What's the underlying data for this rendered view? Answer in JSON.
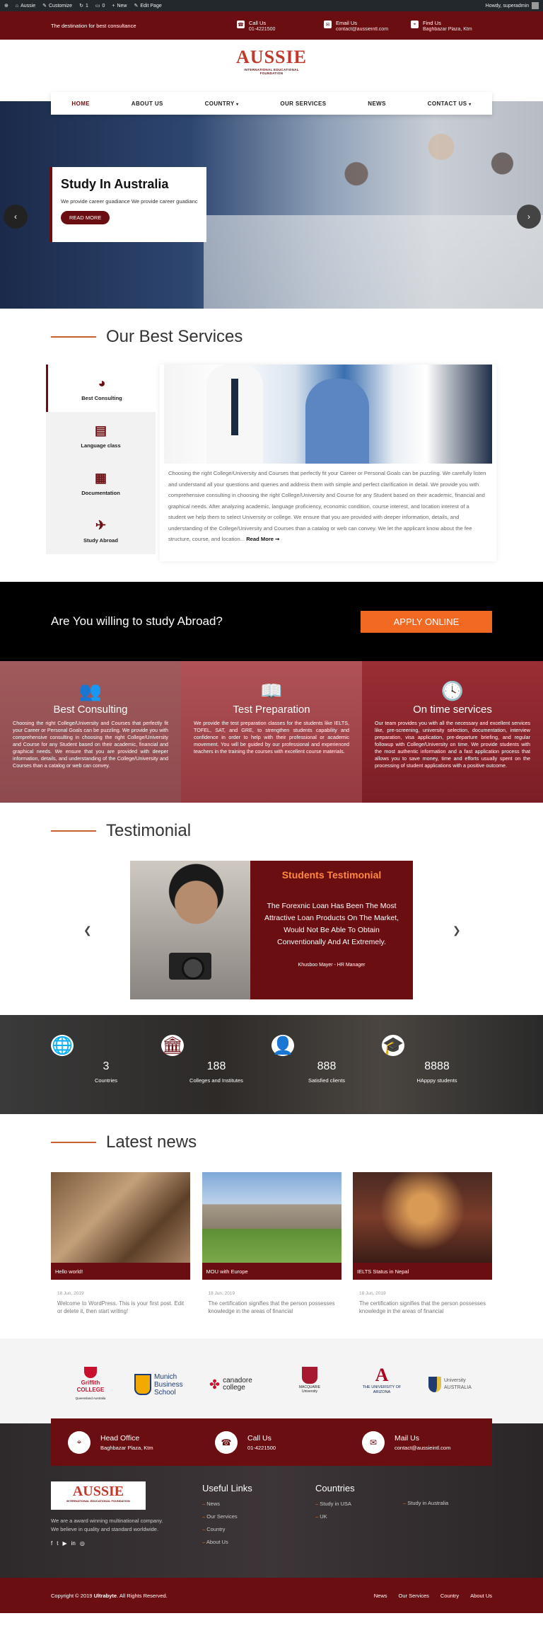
{
  "admin_bar": {
    "site": "Aussie",
    "customize": "Customize",
    "comments": "1",
    "updates": "0",
    "new": "New",
    "edit": "Edit Page",
    "howdy": "Howdy, superadmin"
  },
  "topbar": {
    "tagline": "The destination for best consultance",
    "call_label": "Call Us",
    "call_value": "01-4221500",
    "email_label": "Email Us",
    "email_value": "contact@aussieintl.com",
    "find_label": "Find Us",
    "find_value": "Baghbazar Plaza, Ktm"
  },
  "logo": {
    "brand_a": "AUSS",
    "brand_b": "IE",
    "subtitle": "INTERNATIONAL EDUCATIONAL FOUNDATION"
  },
  "nav": {
    "items": [
      "HOME",
      "ABOUT US",
      "COUNTRY",
      "OUR SERVICES",
      "NEWS",
      "CONTACT US"
    ]
  },
  "hero": {
    "title": "Study In Australia",
    "text": "We provide career guadiance We provide career guadianc",
    "button": "READ MORE"
  },
  "services": {
    "title": "Our Best Services",
    "tabs": [
      "Best Consulting",
      "Language class",
      "Documentation",
      "Study Abroad"
    ],
    "body": "Choosing the right College/University and Courses that perfectly fit your Career or Personal Goals can be puzzling. We carefully listen and understand all your questions and queries and address them with simple and perfect clarification in detail.  We provide you with comprehensive consulting in choosing the right College/University and Course for any Student based on their academic, financial and graphical needs. After analyzing academic, language proficiency, economic condition, course interest, and location interest of a student we help them to select University or college. We ensure that you are provided with deeper information, details, and understanding of the College/University and Courses than a catalog or web can convey.  We let the applicant know about the fee structure, course, and location...",
    "read_more": "Read More ➞"
  },
  "cta": {
    "text": "Are You willing to study Abroad?",
    "button": "APPLY ONLINE"
  },
  "features": [
    {
      "title": "Best Consulting",
      "text": "Choosing the right College/University and Courses that perfectly fit your Career or Personal Goals can be puzzling.  We provide you with comprehensive consulting in choosing the right College/University and Course for any Student based on their academic, financial and graphical needs. We ensure that you are provided with deeper information, details, and understanding of the College/University and Courses than a catalog or web can convey."
    },
    {
      "title": "Test Preparation",
      "text": "We provide the test preparation classes for the students like IELTS, TOFEL, SAT, and GRE, to strengthen students capability and confidence in order to help with their professional or academic movement. You will be guided by our professional and experienced teachers in the training the courses with excellent course materials."
    },
    {
      "title": "On time services",
      "text": "Our team provides you with all the necessary and excellent services like, pre-screening, university selection, documentation, interview preparation, visa application, pre-departure briefing, and regular followup with College/University on time. We provide students with the most authentic information and a fast application process that allows you to save money, time and efforts usually spent on the processing of student applications with a positive outcome."
    }
  ],
  "testimonial": {
    "title": "Testimonial",
    "heading": "Students Testimonial",
    "quote": "The Forexnic Loan Has Been The Most Attractive Loan Products On The Market, Would Not Be Able To Obtain Conventionally And At Extremely.",
    "author": "Khusboo Mayer - HR Manager"
  },
  "counters": [
    {
      "num": "3",
      "label": "Countries"
    },
    {
      "num": "188",
      "label": "Colleges and Institutes"
    },
    {
      "num": "888",
      "label": "Satisfied clients"
    },
    {
      "num": "8888",
      "label": "HApppy students"
    }
  ],
  "news": {
    "title": "Latest news",
    "items": [
      {
        "caption": "Hello world!",
        "date": "18 Jun, 2019",
        "excerpt": "Welcome to WordPress. This is your first post. Edit or delete it, then start writing!"
      },
      {
        "caption": "MOU with Europe",
        "date": "18 Jun, 2019",
        "excerpt": "The certification signifies that the person possesses knowledge in the areas of financial"
      },
      {
        "caption": "IELTS Status in Nepal",
        "date": "18 Jun, 2019",
        "excerpt": "The certification signifies that the person possesses knowledge in the areas of financial"
      }
    ]
  },
  "partners": {
    "griffith": "Griffith COLLEGE",
    "griffith_sub": "Queensland Australia",
    "munich": "Munich Business School",
    "canadore": "canadore college",
    "macquarie": "MACQUARIE University",
    "arizona": "THE UNIVERSITY OF ARIZONA",
    "usq": "University AUSTRALIA"
  },
  "contact": {
    "office_label": "Head Office",
    "office_value": "Baghbazar Plaza, Ktm",
    "call_label": "Call Us",
    "call_value": "01-4221500",
    "mail_label": "Mail Us",
    "mail_value": "contact@aussieintl.com"
  },
  "footer": {
    "about": "We are a award winning multinational company. We believe in quality and standard worldwide.",
    "useful_title": "Useful Links",
    "useful_links": [
      "News",
      "Our Services",
      "Country",
      "About Us"
    ],
    "countries_title": "Countries",
    "countries_a": [
      "Study in USA",
      "UK"
    ],
    "countries_b": [
      "Study in Australia"
    ],
    "copyright_a": "Copyright © 2019 ",
    "copyright_b": "Ultrabyte",
    "copyright_c": ". All Rights Reserved.",
    "bottom_links": [
      "News",
      "Our Services",
      "Country",
      "About Us"
    ]
  },
  "colors": {
    "primary": "#6a0e12",
    "accent": "#f26a21",
    "title_accent": "#c8602e"
  }
}
